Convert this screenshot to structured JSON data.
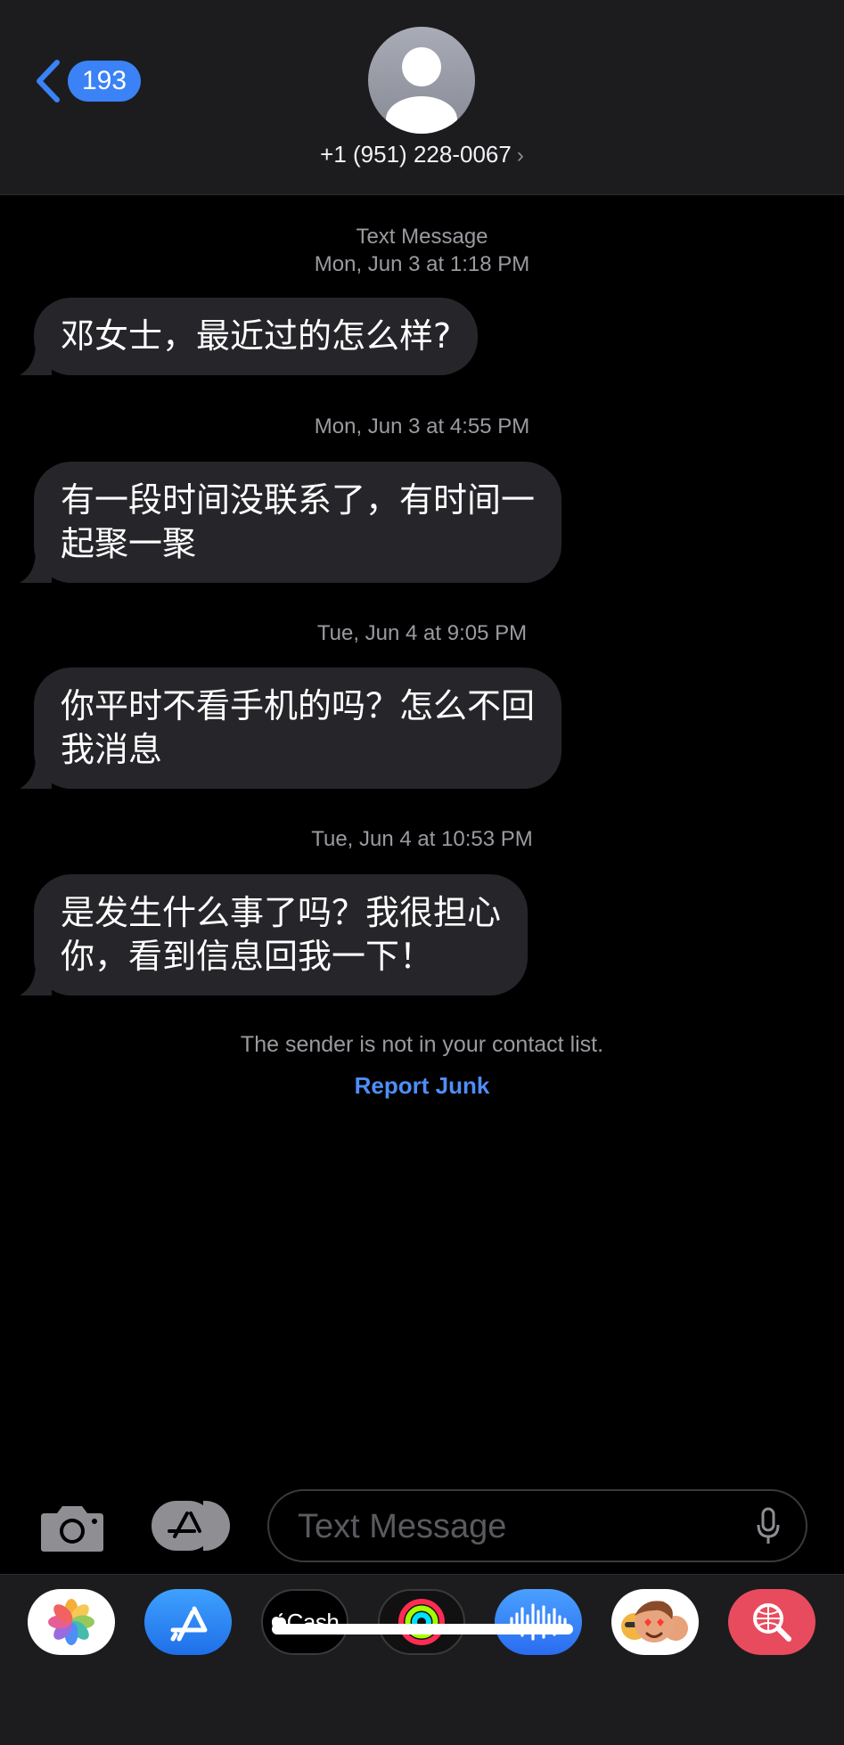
{
  "header": {
    "back_badge": "193",
    "contact_name": "+1 (951) 228-0067",
    "contact_chevron": "›"
  },
  "thread": {
    "header_label": "Text Message",
    "messages": [
      {
        "timestamp": "Mon, Jun 3 at 1:18 PM",
        "lines": [
          "邓女士，最近过的怎么样?"
        ]
      },
      {
        "timestamp": "Mon, Jun 3 at 4:55 PM",
        "lines": [
          "有一段时间没联系了，有时间一",
          "起聚一聚"
        ]
      },
      {
        "timestamp": "Tue, Jun 4 at 9:05 PM",
        "lines": [
          "你平时不看手机的吗？怎么不回",
          "我消息"
        ]
      },
      {
        "timestamp": "Tue, Jun 4 at 10:53 PM",
        "lines": [
          "是发生什么事了吗？我很担心",
          "你，看到信息回我一下！"
        ]
      }
    ],
    "notice": "The sender is not in your contact list.",
    "report_junk": "Report Junk"
  },
  "composer": {
    "placeholder": "Text Message",
    "camera_icon": "camera-icon",
    "apps_icon": "app-store-icon",
    "mic_icon": "microphone-icon"
  },
  "app_drawer": {
    "apps": [
      {
        "name": "Photos",
        "icon": "photos-icon"
      },
      {
        "name": "App Store",
        "icon": "app-store-icon"
      },
      {
        "name": "Cash",
        "icon": "apple-cash-icon",
        "label": "Cash"
      },
      {
        "name": "Activity",
        "icon": "activity-rings-icon"
      },
      {
        "name": "Audio",
        "icon": "audio-waveform-icon"
      },
      {
        "name": "Memoji",
        "icon": "memoji-icon"
      },
      {
        "name": "Images",
        "icon": "image-search-icon"
      }
    ]
  },
  "colors": {
    "accent": "#3a82f6",
    "link": "#4f8ef7",
    "bubble": "#26262a",
    "header_bg": "#1c1c1e"
  }
}
